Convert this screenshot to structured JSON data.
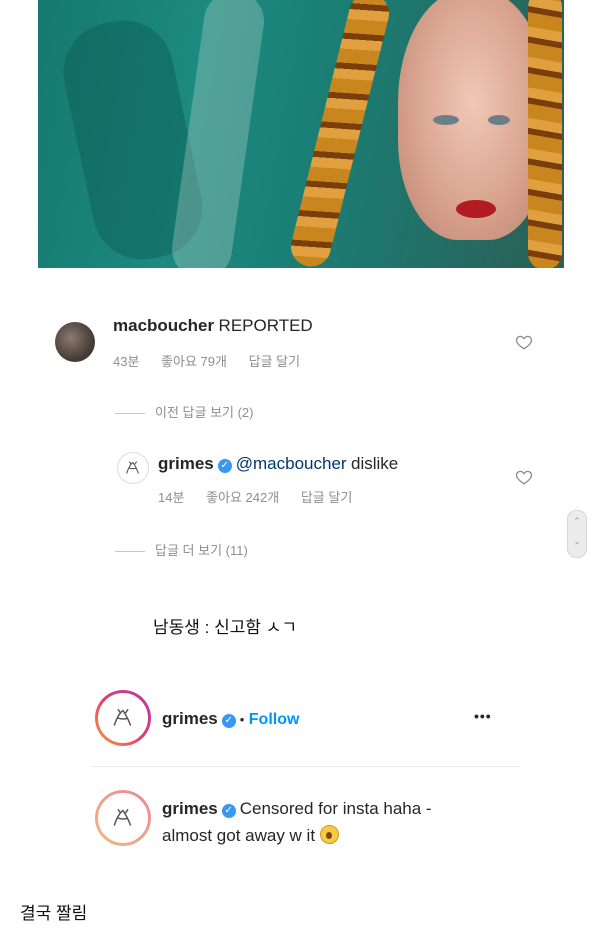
{
  "comment1": {
    "username": "macboucher",
    "text": "REPORTED",
    "time": "43분",
    "likes": "좋아요 79개",
    "reply": "답글 달기"
  },
  "view_prev_replies": "이전 답글 보기 (2)",
  "reply1": {
    "username": "grimes",
    "mention": "@macboucher",
    "text": "dislike",
    "time": "14분",
    "likes": "좋아요 242개",
    "reply": "답글 달기"
  },
  "view_more_replies": "답글 더 보기 (11)",
  "caption_top": "남동생 : 신고함 ㅅㄱ",
  "post_header": {
    "username": "grimes",
    "separator": "•",
    "follow": "Follow",
    "more": "•••"
  },
  "post_caption": {
    "username": "grimes",
    "text_line1": "Censored for insta haha -",
    "text_line2": "almost got away w it"
  },
  "caption_bottom": "결국 짤림",
  "icons": {
    "like": "heart-icon",
    "verified": "verified-badge-icon",
    "more": "more-options-icon",
    "emoji": "astonished-face-emoji"
  },
  "colors": {
    "follow": "#0095f6",
    "verified": "#3897f0",
    "meta": "#8e8e8e"
  }
}
